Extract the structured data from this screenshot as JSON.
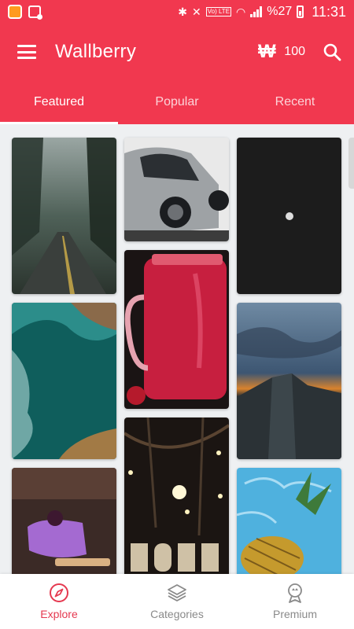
{
  "status_bar": {
    "battery": "%27",
    "time": "11:31",
    "lte_label": "Vo) LTE"
  },
  "app_bar": {
    "title": "Wallberry",
    "coin_symbol": "₩",
    "coins": "100",
    "menu_icon": "menu-icon",
    "search_icon": "search-icon"
  },
  "tabs": [
    {
      "label": "Featured",
      "active": true
    },
    {
      "label": "Popular",
      "active": false
    },
    {
      "label": "Recent",
      "active": false
    }
  ],
  "wallpapers": [
    {
      "subject": "foggy forest road"
    },
    {
      "subject": "silver sports car"
    },
    {
      "subject": "moon in dark sky"
    },
    {
      "subject": "red smoothie jar"
    },
    {
      "subject": "ocean cliffs aerial"
    },
    {
      "subject": "mountain at sunset"
    },
    {
      "subject": "purple ice cream"
    },
    {
      "subject": "HOPE light bulbs"
    },
    {
      "subject": "pineapple in pool"
    }
  ],
  "bottom_nav": [
    {
      "label": "Explore",
      "icon": "compass-icon",
      "active": true
    },
    {
      "label": "Categories",
      "icon": "layers-icon",
      "active": false
    },
    {
      "label": "Premium",
      "icon": "premium-badge-icon",
      "active": false
    }
  ],
  "colors": {
    "brand": "#f1384f",
    "active_nav": "#e53950",
    "inactive_nav": "#8a8a8a",
    "background": "#eef0f2"
  }
}
